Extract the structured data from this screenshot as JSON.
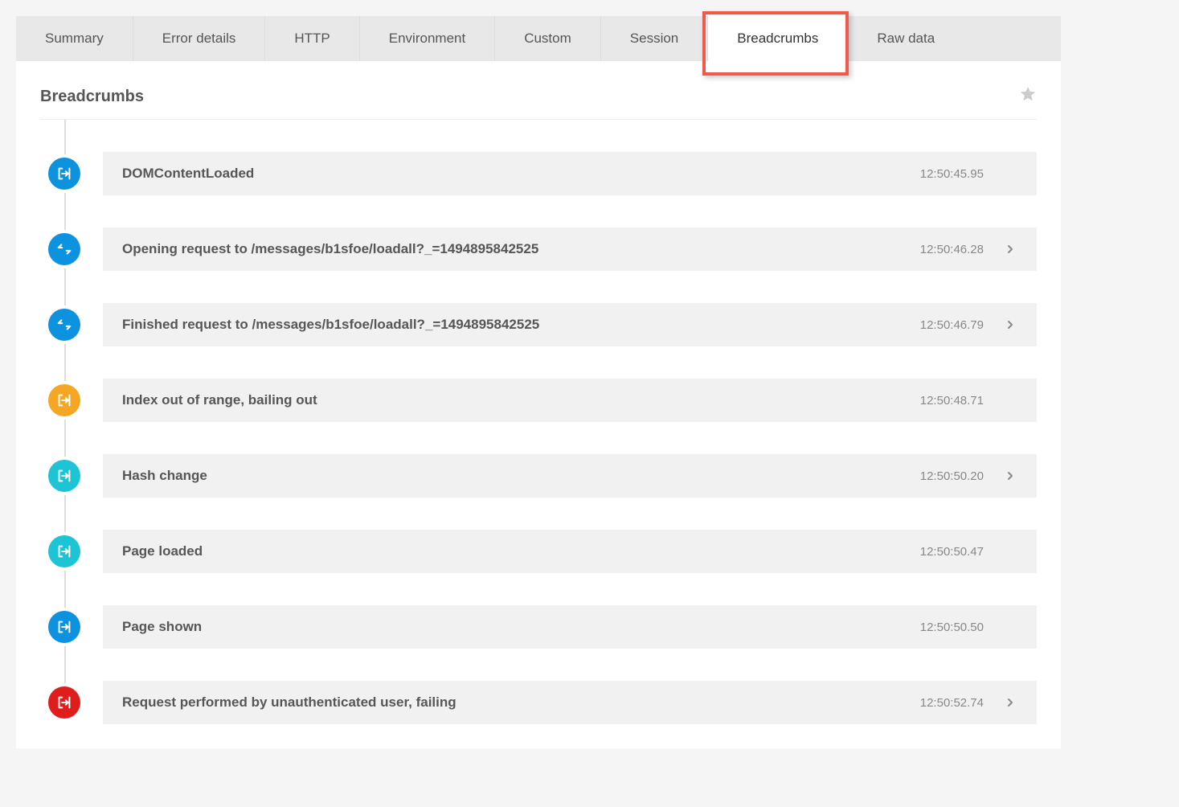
{
  "colors": {
    "blue": "#0d92e0",
    "orange": "#f5a623",
    "teal": "#1dc4d6",
    "red": "#e01d1d",
    "highlight": "#f05a4b"
  },
  "tabs": [
    {
      "label": "Summary",
      "active": false
    },
    {
      "label": "Error details",
      "active": false
    },
    {
      "label": "HTTP",
      "active": false
    },
    {
      "label": "Environment",
      "active": false
    },
    {
      "label": "Custom",
      "active": false
    },
    {
      "label": "Session",
      "active": false
    },
    {
      "label": "Breadcrumbs",
      "active": true
    },
    {
      "label": "Raw data",
      "active": false
    }
  ],
  "panel": {
    "title": "Breadcrumbs"
  },
  "crumbs": [
    {
      "icon": "nav",
      "color": "blue",
      "message": "DOMContentLoaded",
      "time": "12:50:45.95",
      "expandable": false
    },
    {
      "icon": "request",
      "color": "blue",
      "message": "Opening request to /messages/b1sfoe/loadall?_=1494895842525",
      "time": "12:50:46.28",
      "expandable": true
    },
    {
      "icon": "request",
      "color": "blue",
      "message": "Finished request to /messages/b1sfoe/loadall?_=1494895842525",
      "time": "12:50:46.79",
      "expandable": true
    },
    {
      "icon": "nav",
      "color": "orange",
      "message": "Index out of range, bailing out",
      "time": "12:50:48.71",
      "expandable": false
    },
    {
      "icon": "nav",
      "color": "teal",
      "message": "Hash change",
      "time": "12:50:50.20",
      "expandable": true
    },
    {
      "icon": "nav",
      "color": "teal",
      "message": "Page loaded",
      "time": "12:50:50.47",
      "expandable": false
    },
    {
      "icon": "nav",
      "color": "blue",
      "message": "Page shown",
      "time": "12:50:50.50",
      "expandable": false
    },
    {
      "icon": "nav",
      "color": "red",
      "message": "Request performed by unauthenticated user, failing",
      "time": "12:50:52.74",
      "expandable": true
    }
  ]
}
